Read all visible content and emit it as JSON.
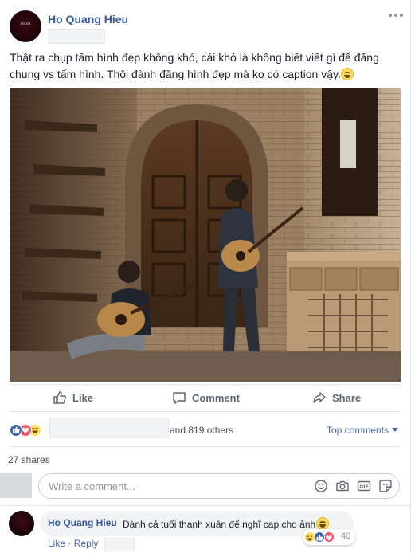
{
  "post": {
    "author": "Ho Quang Hieu",
    "text": "Thật ra chụp tấm hình đẹp không khó, cái khó là không biết viết gì để đăng chung vs tấm hình. Thôi đành đăng hình đẹp mà ko có caption vậy."
  },
  "actions": {
    "like": "Like",
    "comment": "Comment",
    "share": "Share"
  },
  "stats": {
    "others": "and 819 others",
    "top_comments": "Top comments",
    "shares": "27 shares"
  },
  "comment_box": {
    "placeholder": "Write a comment..."
  },
  "comment": {
    "author": "Ho Quang Hieu",
    "text": "Dành cả tuổi thanh xuân để nghĩ cap cho ảnh",
    "reaction_count": "40",
    "like": "Like",
    "reply": "Reply"
  },
  "colors": {
    "link_blue": "#365899",
    "like_blue": "#4267b2",
    "love_red": "#f25268",
    "haha_yellow": "#ffd95a"
  }
}
